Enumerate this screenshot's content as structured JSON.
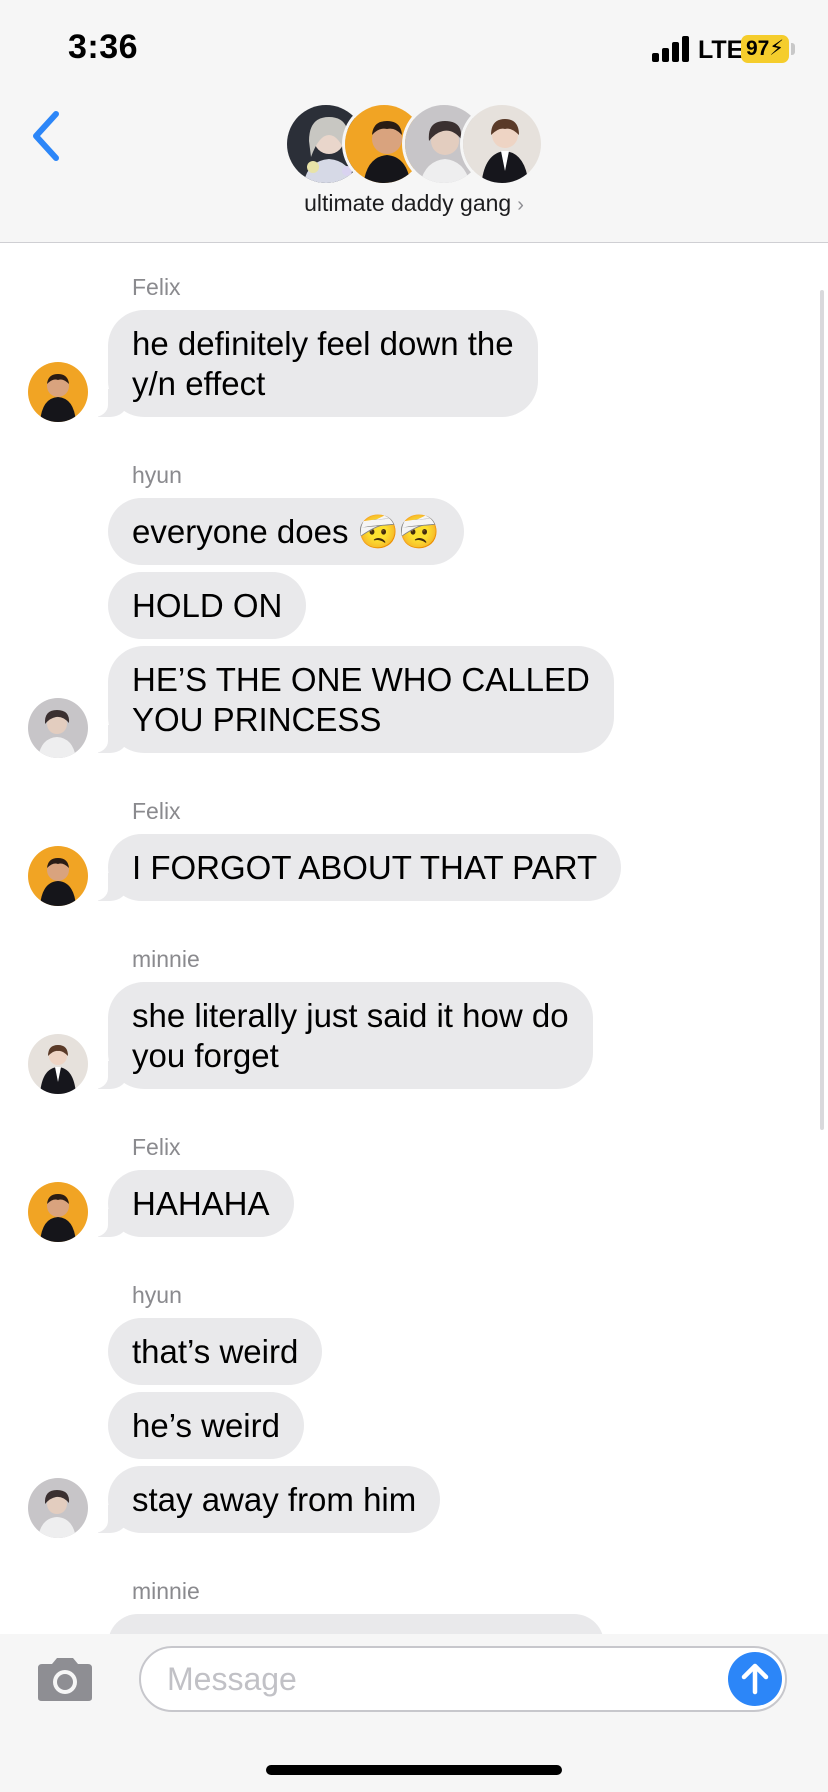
{
  "status_bar": {
    "time": "3:36",
    "network": "LTE",
    "battery": "97"
  },
  "header": {
    "group_name": "ultimate daddy gang",
    "back_icon": "chevron-left-icon",
    "info_icon": "chevron-right-icon"
  },
  "messages": [
    {
      "sender": "Felix",
      "bubbles": [
        "he definitely feel down the",
        "y/n effect"
      ]
    },
    {
      "sender": "hyun",
      "bubbles": [
        "everyone does 🤕🤕",
        "HOLD ON",
        "HE’S THE ONE WHO CALLED",
        "YOU PRINCESS"
      ]
    },
    {
      "sender": "Felix",
      "bubbles": [
        "I FORGOT ABOUT THAT PART"
      ]
    },
    {
      "sender": "minnie",
      "bubbles": [
        "she literally just said it how do",
        "you forget"
      ]
    },
    {
      "sender": "Felix",
      "bubbles": [
        "HAHAHA"
      ]
    },
    {
      "sender": "hyun",
      "bubbles": [
        "that’s weird",
        "he’s weird",
        "stay away from him"
      ]
    },
    {
      "sender": "minnie"
    }
  ],
  "composer": {
    "placeholder": "Message",
    "camera_icon": "camera-icon",
    "send_icon": "arrow-up-icon"
  },
  "colors": {
    "accent": "#2c86f8",
    "incoming_bubble": "#e9e9eb",
    "battery": "#f5cd2c"
  }
}
